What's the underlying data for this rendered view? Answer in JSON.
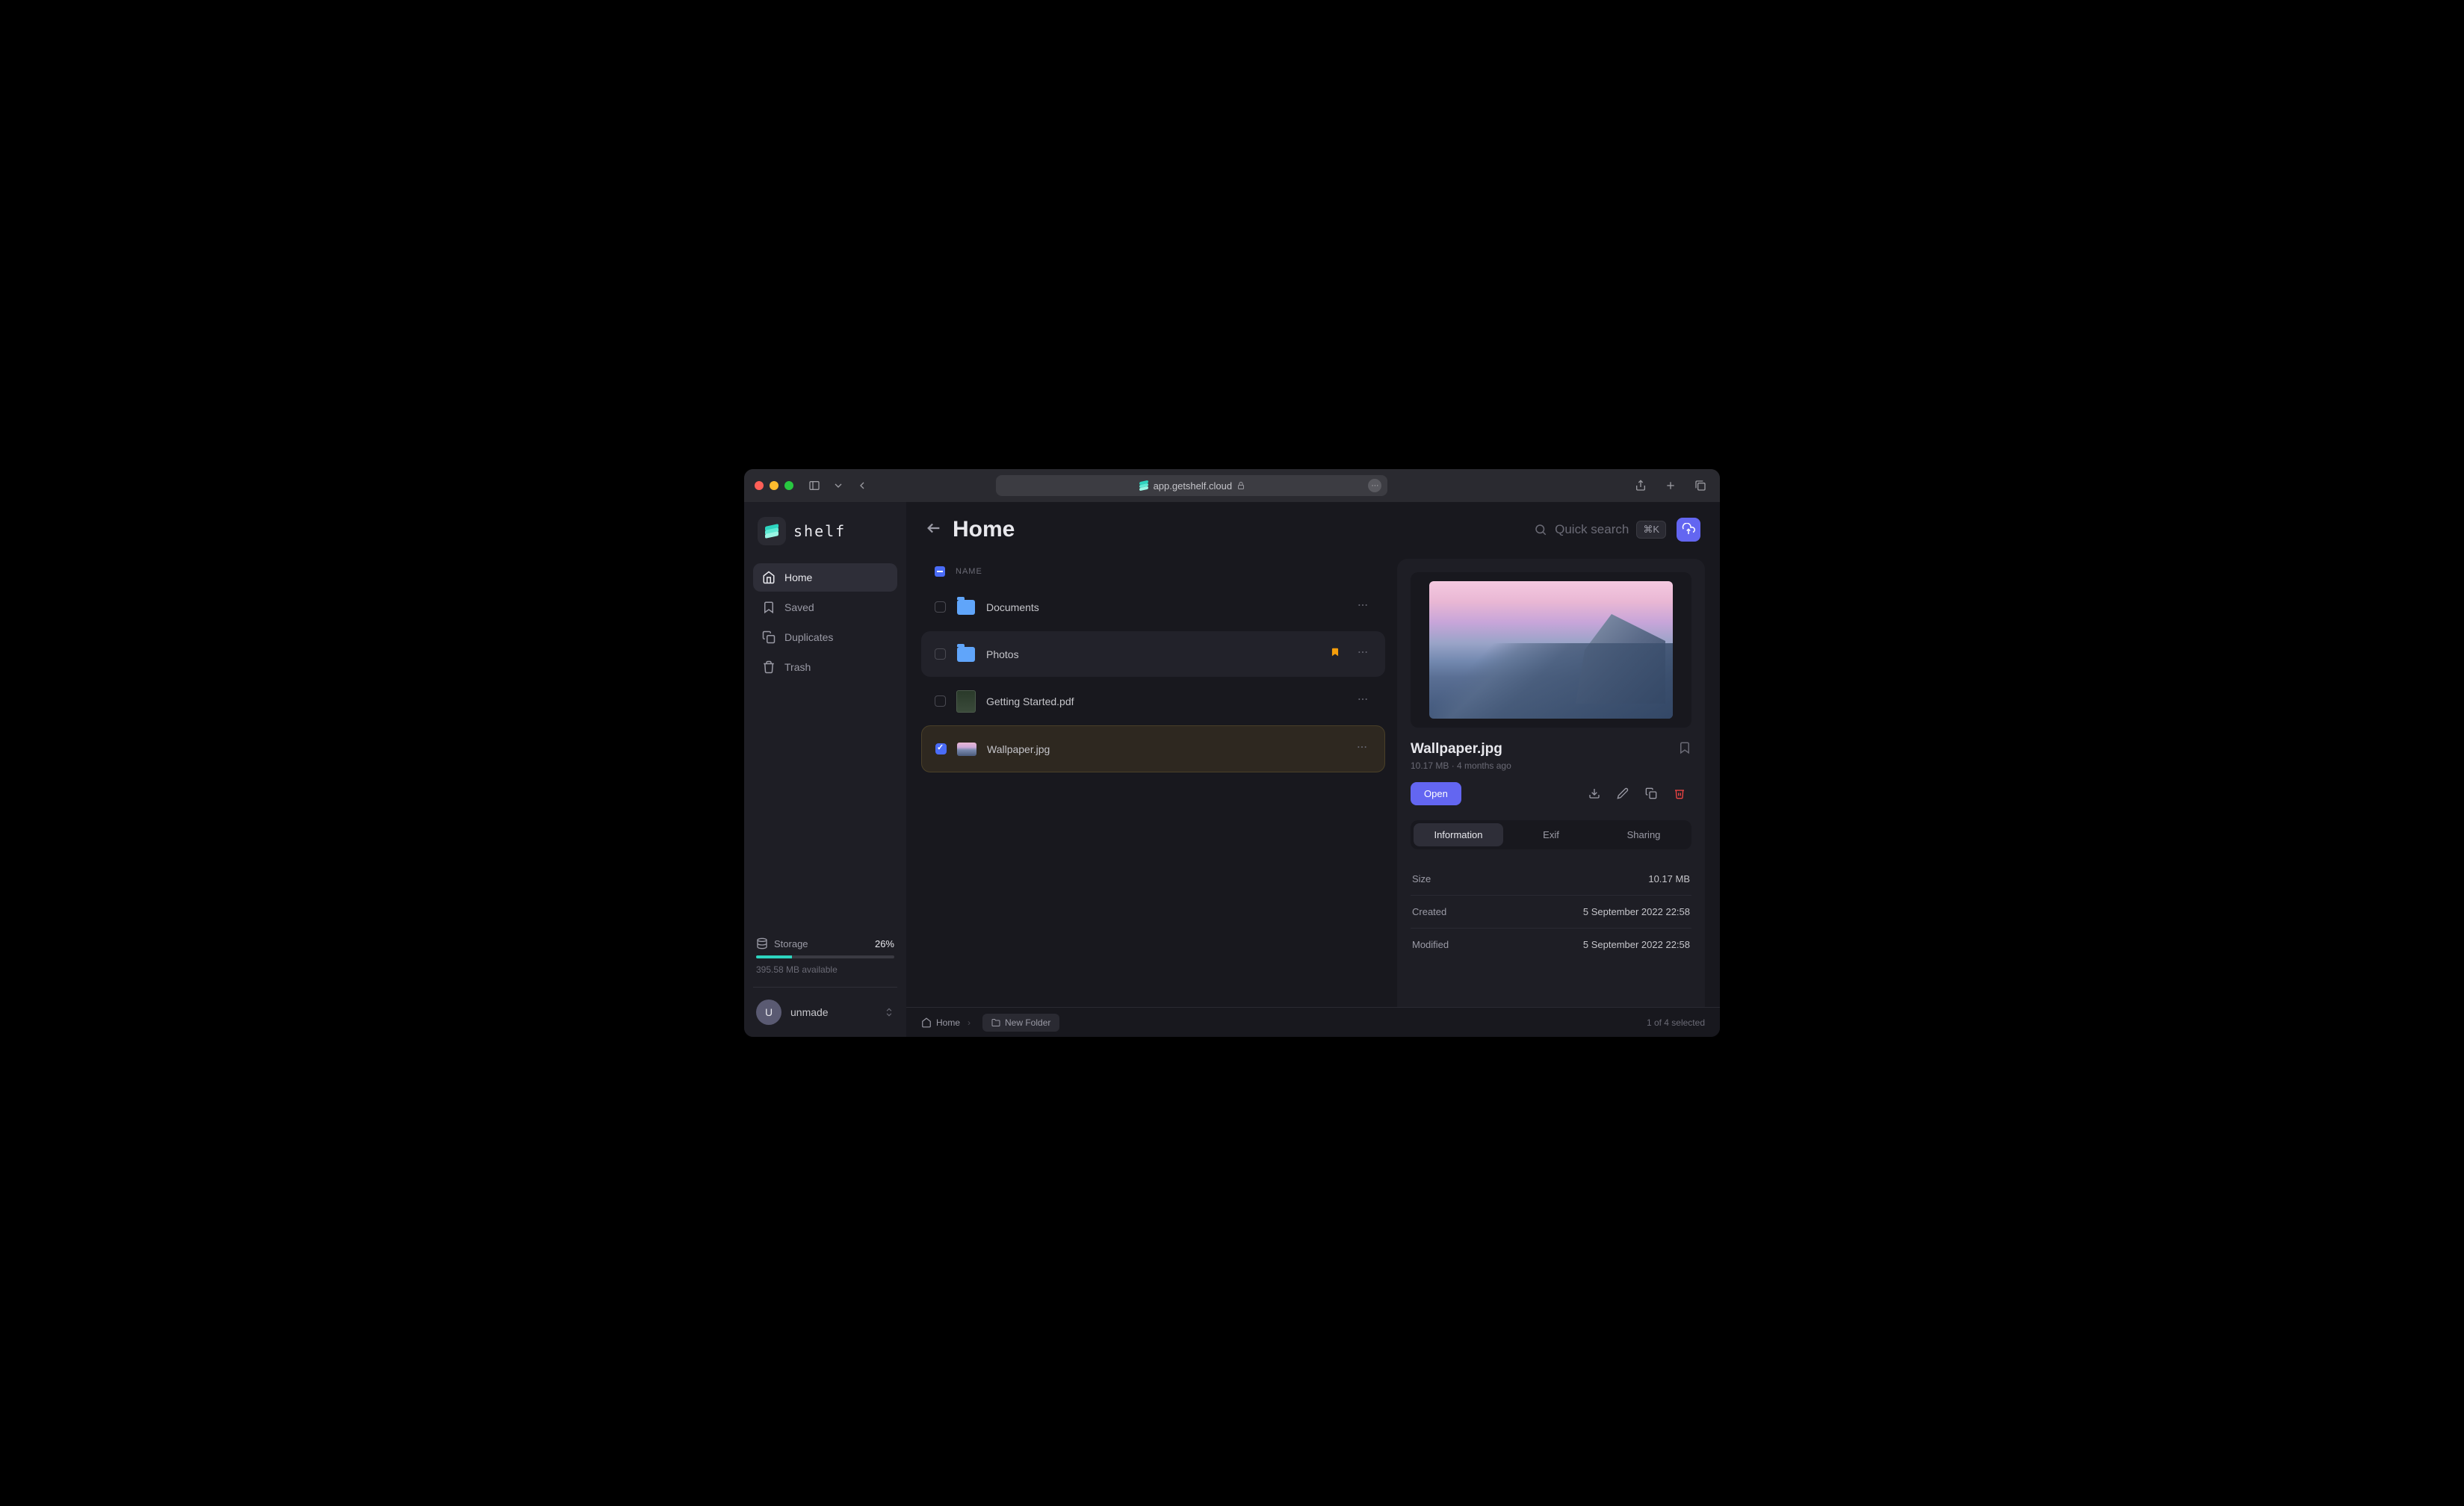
{
  "url": "app.getshelf.cloud",
  "app_name": "shelf",
  "page_title": "Home",
  "search_placeholder": "Quick search",
  "search_shortcut": "⌘K",
  "sidebar": {
    "nav": [
      {
        "label": "Home",
        "icon": "home",
        "active": true
      },
      {
        "label": "Saved",
        "icon": "bookmark",
        "active": false
      },
      {
        "label": "Duplicates",
        "icon": "copy",
        "active": false
      },
      {
        "label": "Trash",
        "icon": "trash",
        "active": false
      }
    ],
    "storage": {
      "label": "Storage",
      "percent": "26%",
      "percent_num": 26,
      "available": "395.58 MB available"
    },
    "user": {
      "initial": "U",
      "name": "unmade"
    }
  },
  "list": {
    "header_label": "NAME",
    "rows": [
      {
        "name": "Documents",
        "type": "folder",
        "selected": false,
        "bookmarked": false,
        "hover": false
      },
      {
        "name": "Photos",
        "type": "folder",
        "selected": false,
        "bookmarked": true,
        "hover": true
      },
      {
        "name": "Getting Started.pdf",
        "type": "pdf",
        "selected": false,
        "bookmarked": false,
        "hover": false
      },
      {
        "name": "Wallpaper.jpg",
        "type": "image",
        "selected": true,
        "bookmarked": false,
        "hover": false
      }
    ]
  },
  "panel": {
    "filename": "Wallpaper.jpg",
    "meta": "10.17 MB · 4 months ago",
    "open_label": "Open",
    "tabs": [
      {
        "label": "Information",
        "active": true
      },
      {
        "label": "Exif",
        "active": false
      },
      {
        "label": "Sharing",
        "active": false
      }
    ],
    "info": [
      {
        "label": "Size",
        "value": "10.17 MB"
      },
      {
        "label": "Created",
        "value": "5 September 2022 22:58"
      },
      {
        "label": "Modified",
        "value": "5 September 2022 22:58"
      }
    ]
  },
  "footer": {
    "breadcrumb": "Home",
    "new_folder": "New Folder",
    "status": "1 of 4 selected"
  }
}
